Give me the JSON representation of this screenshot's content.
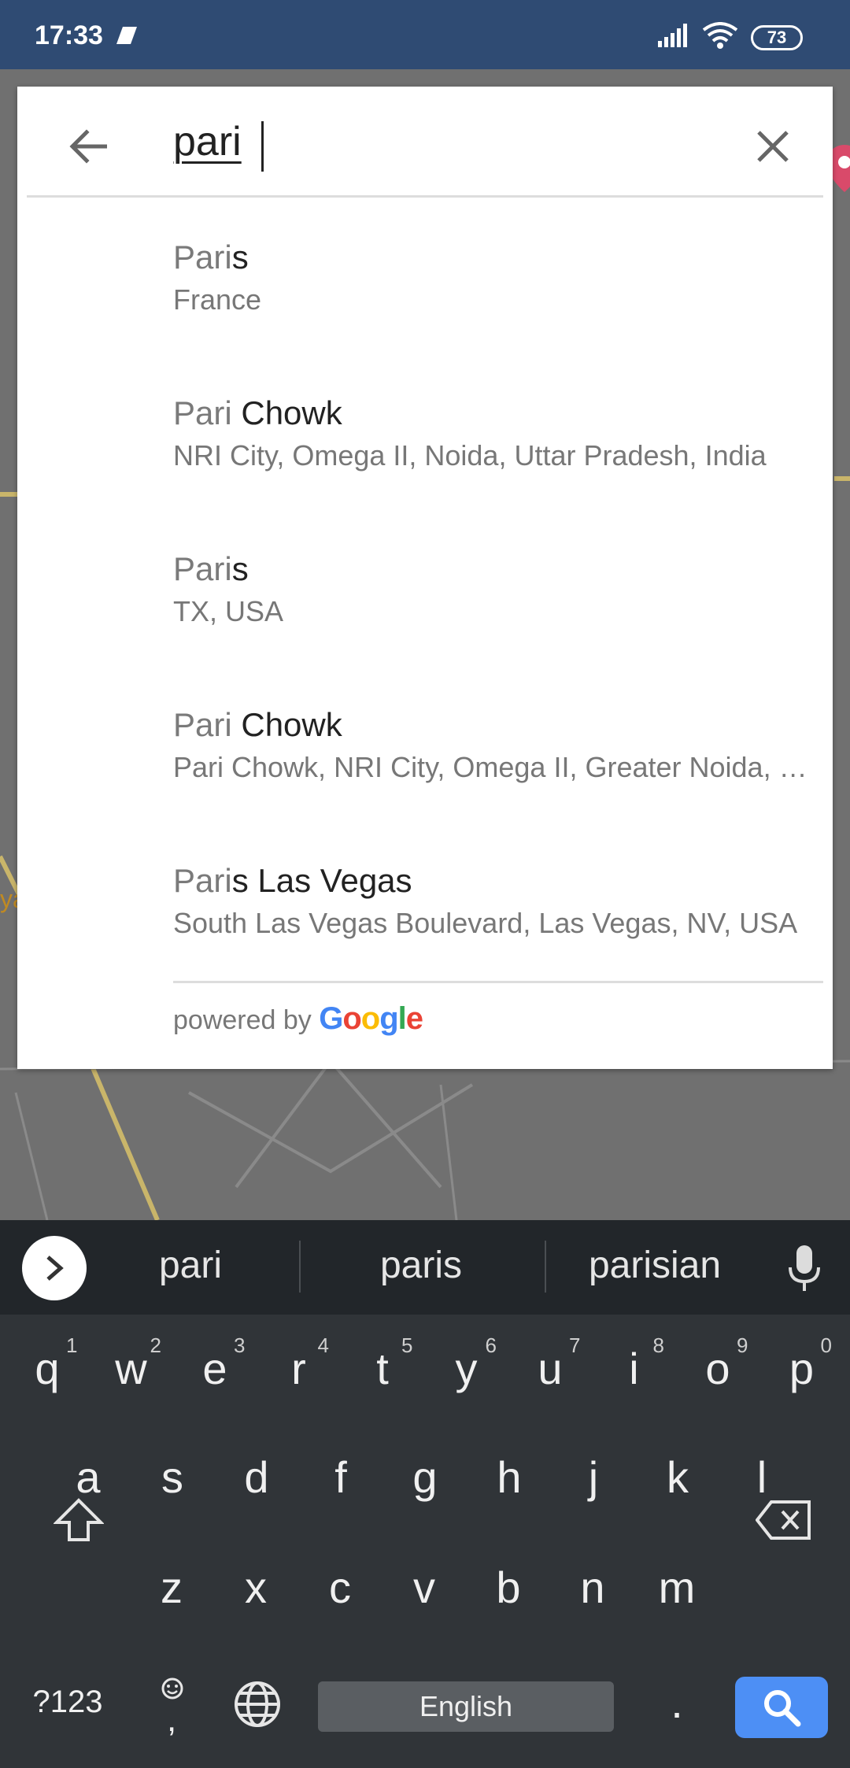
{
  "status_bar": {
    "time": "17:33",
    "battery": "73"
  },
  "map": {
    "partial_label": "ya"
  },
  "search": {
    "query": "pari"
  },
  "results": [
    {
      "match": "Pari",
      "rest": "s",
      "subtitle": "France"
    },
    {
      "match": "Pari",
      "rest": " Chowk",
      "subtitle": "NRI City, Omega II, Noida, Uttar Pradesh, India"
    },
    {
      "match": "Pari",
      "rest": "s",
      "subtitle": "TX, USA"
    },
    {
      "match": "Pari",
      "rest": " Chowk",
      "subtitle": "Pari Chowk, NRI City, Omega II, Greater Noida, Uttar Pradesh, India"
    },
    {
      "match": "Pari",
      "rest": "s Las Vegas",
      "subtitle": "South Las Vegas Boulevard, Las Vegas, NV, USA"
    }
  ],
  "powered_by": {
    "label": "powered by",
    "brand": [
      "G",
      "o",
      "o",
      "g",
      "l",
      "e"
    ]
  },
  "keyboard": {
    "suggestions": [
      "pari",
      "paris",
      "parisian"
    ],
    "row1": [
      "q",
      "w",
      "e",
      "r",
      "t",
      "y",
      "u",
      "i",
      "o",
      "p"
    ],
    "row1_hints": [
      "1",
      "2",
      "3",
      "4",
      "5",
      "6",
      "7",
      "8",
      "9",
      "0"
    ],
    "row2": [
      "a",
      "s",
      "d",
      "f",
      "g",
      "h",
      "j",
      "k",
      "l"
    ],
    "row3": [
      "z",
      "x",
      "c",
      "v",
      "b",
      "n",
      "m"
    ],
    "symbols_key": "?123",
    "comma_key": ",",
    "period_key": ".",
    "space_label": "English"
  },
  "colors": {
    "status_bar": "#2f4b73",
    "accent_search_key": "#4d8ff5"
  }
}
